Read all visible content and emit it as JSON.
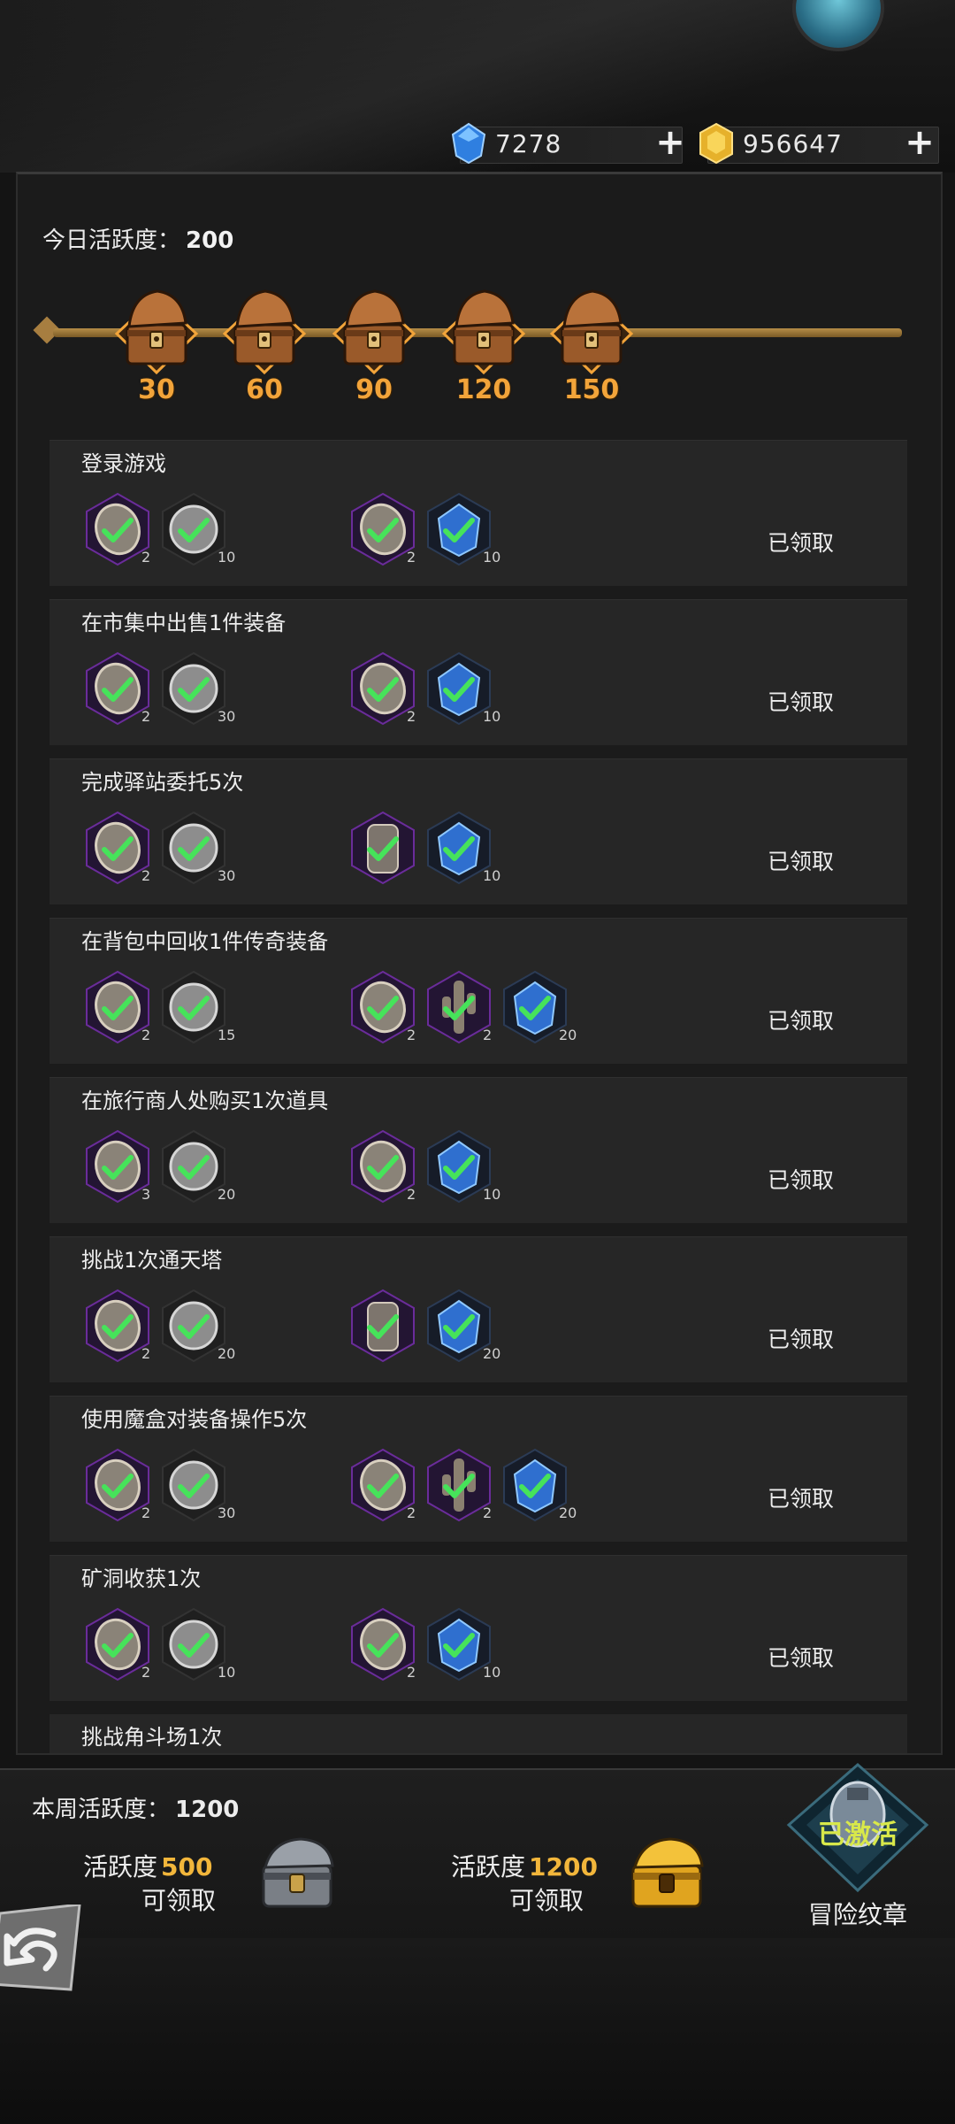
{
  "currency": {
    "diamond": "7278",
    "gold": "956647",
    "diamond_icon": "blue-diamond-icon",
    "gold_icon": "gold-coin-icon"
  },
  "daily": {
    "label": "今日活跃度：",
    "value": "200",
    "milestones": [
      "30",
      "60",
      "90",
      "120",
      "150"
    ]
  },
  "tasks": [
    {
      "title": "登录游戏",
      "status": "已领取",
      "rewards": [
        {
          "icon": "stone-token",
          "count": "2"
        },
        {
          "icon": "silver-coin",
          "count": "10"
        }
      ],
      "rewards2": [
        {
          "icon": "stone-token",
          "count": "2"
        },
        {
          "icon": "blue-crystal",
          "count": "10"
        }
      ]
    },
    {
      "title": "在市集中出售1件装备",
      "status": "已领取",
      "rewards": [
        {
          "icon": "stone-token",
          "count": "2"
        },
        {
          "icon": "silver-coin",
          "count": "30"
        }
      ],
      "rewards2": [
        {
          "icon": "stone-token",
          "count": "2"
        },
        {
          "icon": "blue-crystal",
          "count": "10"
        }
      ]
    },
    {
      "title": "完成驿站委托5次",
      "status": "已领取",
      "rewards": [
        {
          "icon": "stone-token",
          "count": "2"
        },
        {
          "icon": "silver-coin",
          "count": "30"
        }
      ],
      "rewards2": [
        {
          "icon": "tablet",
          "count": ""
        },
        {
          "icon": "blue-crystal",
          "count": "10"
        }
      ]
    },
    {
      "title": "在背包中回收1件传奇装备",
      "status": "已领取",
      "rewards": [
        {
          "icon": "stone-token",
          "count": "2"
        },
        {
          "icon": "silver-coin",
          "count": "15"
        }
      ],
      "rewards2": [
        {
          "icon": "stone-token",
          "count": "2"
        },
        {
          "icon": "cactus-totem",
          "count": "2"
        },
        {
          "icon": "blue-crystal",
          "count": "20"
        }
      ]
    },
    {
      "title": "在旅行商人处购买1次道具",
      "status": "已领取",
      "rewards": [
        {
          "icon": "stone-token",
          "count": "3"
        },
        {
          "icon": "silver-coin",
          "count": "20"
        }
      ],
      "rewards2": [
        {
          "icon": "stone-token",
          "count": "2"
        },
        {
          "icon": "blue-crystal",
          "count": "10"
        }
      ]
    },
    {
      "title": "挑战1次通天塔",
      "status": "已领取",
      "rewards": [
        {
          "icon": "stone-token",
          "count": "2"
        },
        {
          "icon": "silver-coin",
          "count": "20"
        }
      ],
      "rewards2": [
        {
          "icon": "tablet",
          "count": ""
        },
        {
          "icon": "blue-crystal",
          "count": "20"
        }
      ]
    },
    {
      "title": "使用魔盒对装备操作5次",
      "status": "已领取",
      "rewards": [
        {
          "icon": "stone-token",
          "count": "2"
        },
        {
          "icon": "silver-coin",
          "count": "30"
        }
      ],
      "rewards2": [
        {
          "icon": "stone-token",
          "count": "2"
        },
        {
          "icon": "cactus-totem",
          "count": "2"
        },
        {
          "icon": "blue-crystal",
          "count": "20"
        }
      ]
    },
    {
      "title": "矿洞收获1次",
      "status": "已领取",
      "rewards": [
        {
          "icon": "stone-token",
          "count": "2"
        },
        {
          "icon": "silver-coin",
          "count": "10"
        }
      ],
      "rewards2": [
        {
          "icon": "stone-token",
          "count": "2"
        },
        {
          "icon": "blue-crystal",
          "count": "10"
        }
      ]
    }
  ],
  "partial_task": {
    "title": "挑战角斗场1次"
  },
  "weekly": {
    "label": "本周活跃度：",
    "value": "1200",
    "reward1": {
      "prefix": "活跃度",
      "num": "500",
      "sub": "可领取"
    },
    "reward2": {
      "prefix": "活跃度",
      "num": "1200",
      "sub": "可领取"
    },
    "medal_status": "已激活",
    "medal_caption": "冒险纹章"
  }
}
